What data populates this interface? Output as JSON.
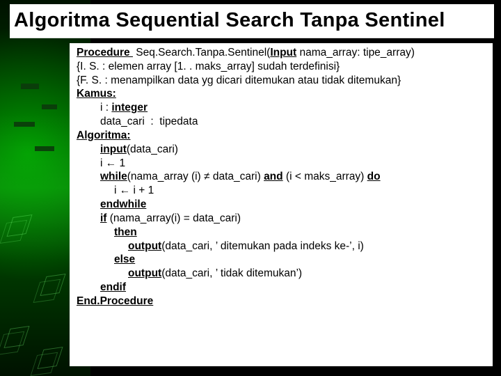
{
  "title": "Algoritma Sequential Search Tanpa Sentinel",
  "code": {
    "proc_kw": "Procedure ",
    "proc_name": " Seq.Search.Tanpa.Sentinel(",
    "input_kw": "Input",
    "proc_sig_tail": " nama_array: tipe_array)",
    "is_line": "{I. S. : elemen array [1. . maks_array] sudah terdefinisi}",
    "fs_line": "{F. S. : menampilkan data yg dicari ditemukan atau tidak ditemukan}",
    "kamus": "Kamus:",
    "i_decl_lead": "i : ",
    "i_decl_type": "integer",
    "data_cari_decl": "data_cari  :  tipedata",
    "algoritma": "Algoritma:",
    "input_call_kw": "input",
    "input_call_args": "(data_cari)",
    "i_assign": "i ← 1",
    "while_kw": "while",
    "while_cond_a": "(nama_array (i) ≠ data_cari) ",
    "and_kw": "and",
    "while_cond_b": " (i < maks_array) ",
    "do_kw": "do",
    "i_incr": "i ← i + 1",
    "endwhile": "endwhile",
    "if_kw": "if",
    "if_cond": " (nama_array(i) = data_cari)",
    "then_kw": "then",
    "out1_kw": "output",
    "out1_args": "(data_cari, ’ ditemukan pada indeks ke-’, i)",
    "else_kw": "else",
    "out2_kw": "output",
    "out2_args": "(data_cari, ’ tidak ditemukan’)",
    "endif": "endif",
    "endproc": "End.Procedure"
  }
}
